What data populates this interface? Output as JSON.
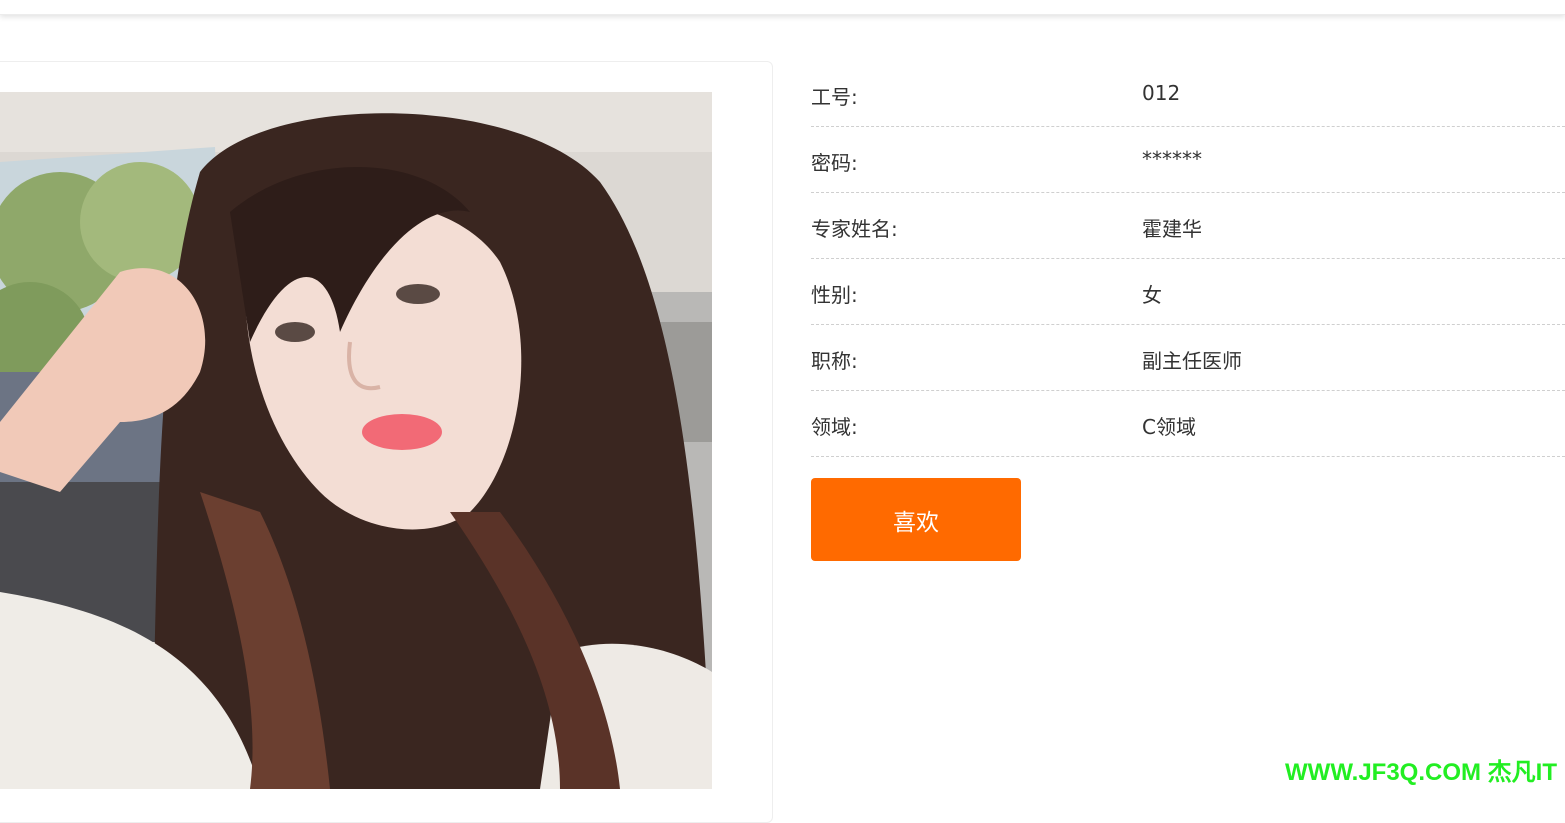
{
  "colors": {
    "accent": "#ff6a00",
    "watermark": "#22ee22"
  },
  "detail": {
    "photo_icon": "portrait-photo",
    "fields": [
      {
        "label": "工号:",
        "value": "012"
      },
      {
        "label": "密码:",
        "value": "******"
      },
      {
        "label": "专家姓名:",
        "value": "霍建华"
      },
      {
        "label": "性别:",
        "value": "女"
      },
      {
        "label": "职称:",
        "value": "副主任医师"
      },
      {
        "label": "领域:",
        "value": "C领域"
      }
    ],
    "like_label": "喜欢"
  },
  "watermark": "WWW.JF3Q.COM 杰凡IT"
}
